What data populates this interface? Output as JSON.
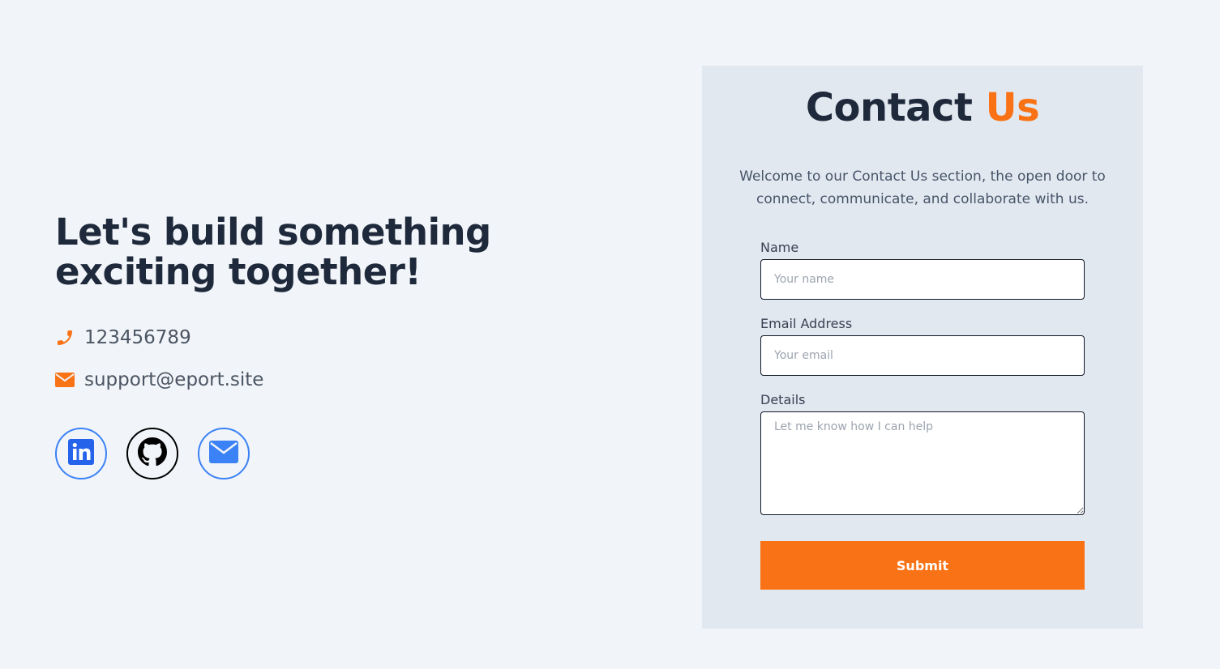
{
  "hero": {
    "headline_line1": "Let's build something",
    "headline_line2": "exciting together!"
  },
  "contact_info": {
    "phone": "123456789",
    "phone_icon": "phone-icon",
    "email": "support@eport.site",
    "email_icon": "envelope-icon"
  },
  "socials": [
    {
      "name": "linkedin",
      "icon": "linkedin-icon",
      "color": "#2563eb"
    },
    {
      "name": "github",
      "icon": "github-icon",
      "color": "#000000"
    },
    {
      "name": "email",
      "icon": "envelope-icon",
      "color": "#3b82f6"
    }
  ],
  "form": {
    "title_main": "Contact",
    "title_accent": "Us",
    "intro": "Welcome to our Contact Us section, the open door to connect, communicate, and collaborate with us.",
    "name_label": "Name",
    "name_placeholder": "Your name",
    "email_label": "Email Address",
    "email_placeholder": "Your email",
    "details_label": "Details",
    "details_placeholder": "Let me know how I can help",
    "submit_label": "Submit"
  },
  "colors": {
    "accent": "#f97316",
    "background": "#f1f4f8",
    "card": "#e2e8f0",
    "social_blue": "#3b82f6"
  }
}
